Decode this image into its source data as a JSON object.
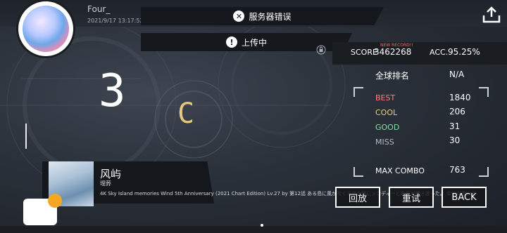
{
  "colors": {
    "best": "#ff7c7c",
    "cool": "#e8d27a",
    "good": "#7fe3a5",
    "miss": "#b6b9be",
    "grade": "#e7c67e",
    "accent_dot": "#f5a623"
  },
  "profile": {
    "username": "Four_",
    "datetime": "2021/9/17 13:17:52"
  },
  "toasts": {
    "server_error": "服务器错误",
    "uploading": "上传中"
  },
  "icons": {
    "error": "close-circle-icon",
    "info": "exclamation-circle-icon",
    "share": "share-upload-icon",
    "lock": "lock-icon"
  },
  "result": {
    "rank_number": "3",
    "grade": "C",
    "score_label": "SCORE",
    "score": "3462268",
    "new_record": "NEW RECORD!!",
    "acc_label": "ACC.",
    "acc": "95.25%",
    "global_rank_label": "全球排名",
    "global_rank_value": "N/A",
    "stats": [
      {
        "label": "BEST",
        "value": "1840"
      },
      {
        "label": "COOL",
        "value": "206"
      },
      {
        "label": "GOOD",
        "value": "31"
      },
      {
        "label": "MISS",
        "value": "30"
      }
    ],
    "max_combo_label": "MAX COMBO",
    "max_combo": "763"
  },
  "song": {
    "title": "风屿",
    "artist": "埋葬",
    "description": "4K Sky Island memories Wind 5th Anniversary (2021 Chart Edition) Lv.27 by 第12話 ある島に風が吹くまでの間にメロディーと歌声が響き渡った。 幸せな思い出"
  },
  "buttons": {
    "replay": "回放",
    "retry": "重试",
    "back": "BACK"
  }
}
